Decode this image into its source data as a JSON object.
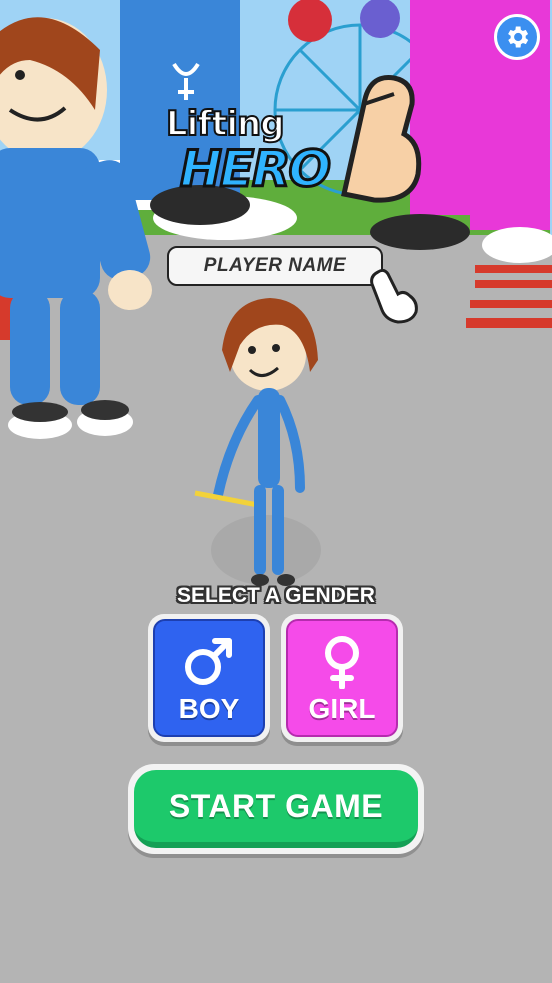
{
  "game": {
    "title_line1": "Lifting",
    "title_line2": "HERO"
  },
  "settings": {
    "icon": "gear-icon"
  },
  "player_name": {
    "placeholder": "PLAYER NAME"
  },
  "gender": {
    "prompt": "SELECT A GENDER",
    "boy_label": "BOY",
    "girl_label": "GIRL",
    "boy_icon": "male-symbol-icon",
    "girl_icon": "female-symbol-icon"
  },
  "start_button": {
    "label": "START GAME"
  },
  "colors": {
    "boy": "#2f63f0",
    "girl": "#f54be9",
    "start": "#1dc96b",
    "settings": "#3b8ff0"
  }
}
